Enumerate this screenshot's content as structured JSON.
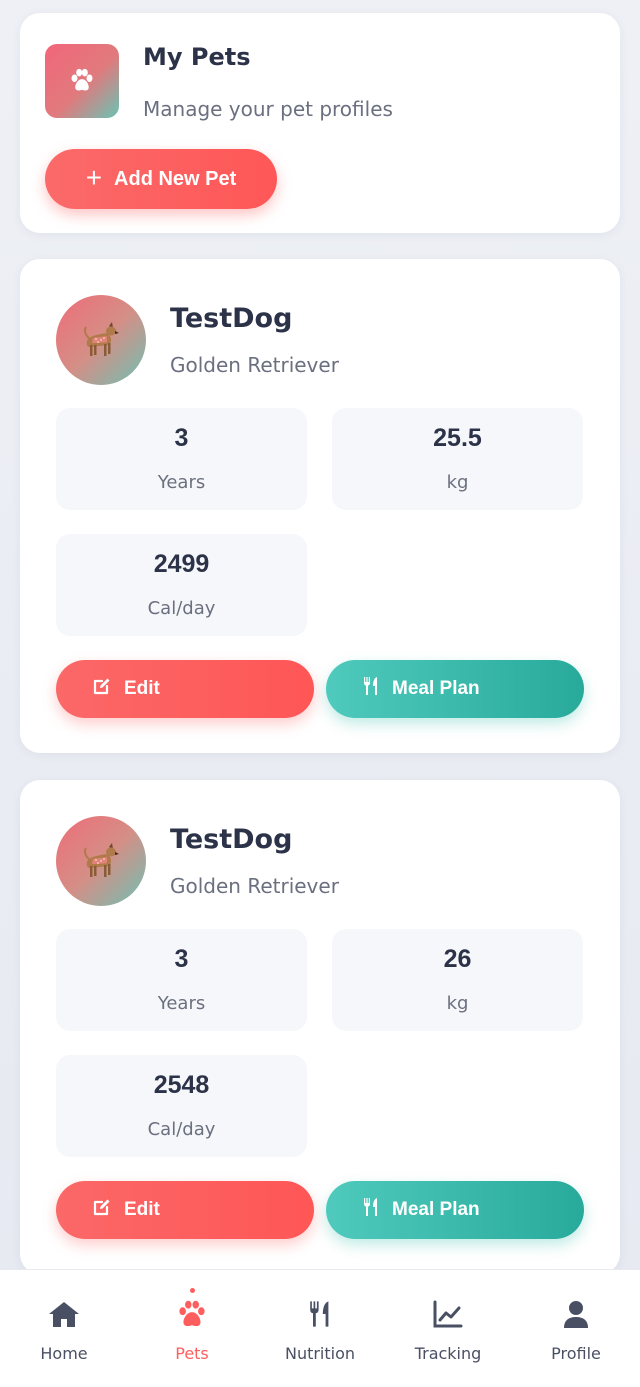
{
  "header": {
    "title": "My Pets",
    "subtitle": "Manage your pet profiles",
    "add_button_label": "Add New Pet",
    "logo_icon": "paw-icon"
  },
  "pets": [
    {
      "name": "TestDog",
      "breed": "Golden Retriever",
      "avatar_icon": "dog-icon",
      "stats": [
        {
          "value": "3",
          "label": "Years"
        },
        {
          "value": "25.5",
          "label": "kg"
        },
        {
          "value": "2499",
          "label": "Cal/day"
        }
      ],
      "edit_label": "Edit",
      "meal_label": "Meal Plan"
    },
    {
      "name": "TestDog",
      "breed": "Golden Retriever",
      "avatar_icon": "dog-icon",
      "stats": [
        {
          "value": "3",
          "label": "Years"
        },
        {
          "value": "26",
          "label": "kg"
        },
        {
          "value": "2548",
          "label": "Cal/day"
        }
      ],
      "edit_label": "Edit",
      "meal_label": "Meal Plan"
    }
  ],
  "nav": {
    "active": "Pets",
    "items": [
      {
        "label": "Home",
        "icon": "home-icon"
      },
      {
        "label": "Pets",
        "icon": "paw-icon"
      },
      {
        "label": "Nutrition",
        "icon": "utensils-icon"
      },
      {
        "label": "Tracking",
        "icon": "chart-line-icon"
      },
      {
        "label": "Profile",
        "icon": "user-icon"
      }
    ]
  },
  "colors": {
    "primary": "#ff5e5e",
    "secondary": "#2db3a3",
    "text": "#2c3348",
    "muted": "#6b7080"
  }
}
